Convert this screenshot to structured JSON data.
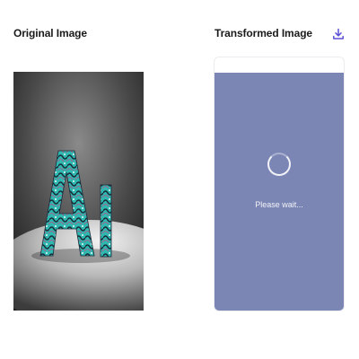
{
  "panels": {
    "original": {
      "title": "Original Image"
    },
    "transformed": {
      "title": "Transformed Image",
      "status_text": "Please wait...",
      "overlay_color": "#7b86b5"
    }
  },
  "icons": {
    "download": "download-icon",
    "spinner": "loading-spinner-icon"
  },
  "colors": {
    "accent": "#5b4fd6",
    "title_text": "#1a1a1a",
    "overlay": "#7b86b5"
  }
}
